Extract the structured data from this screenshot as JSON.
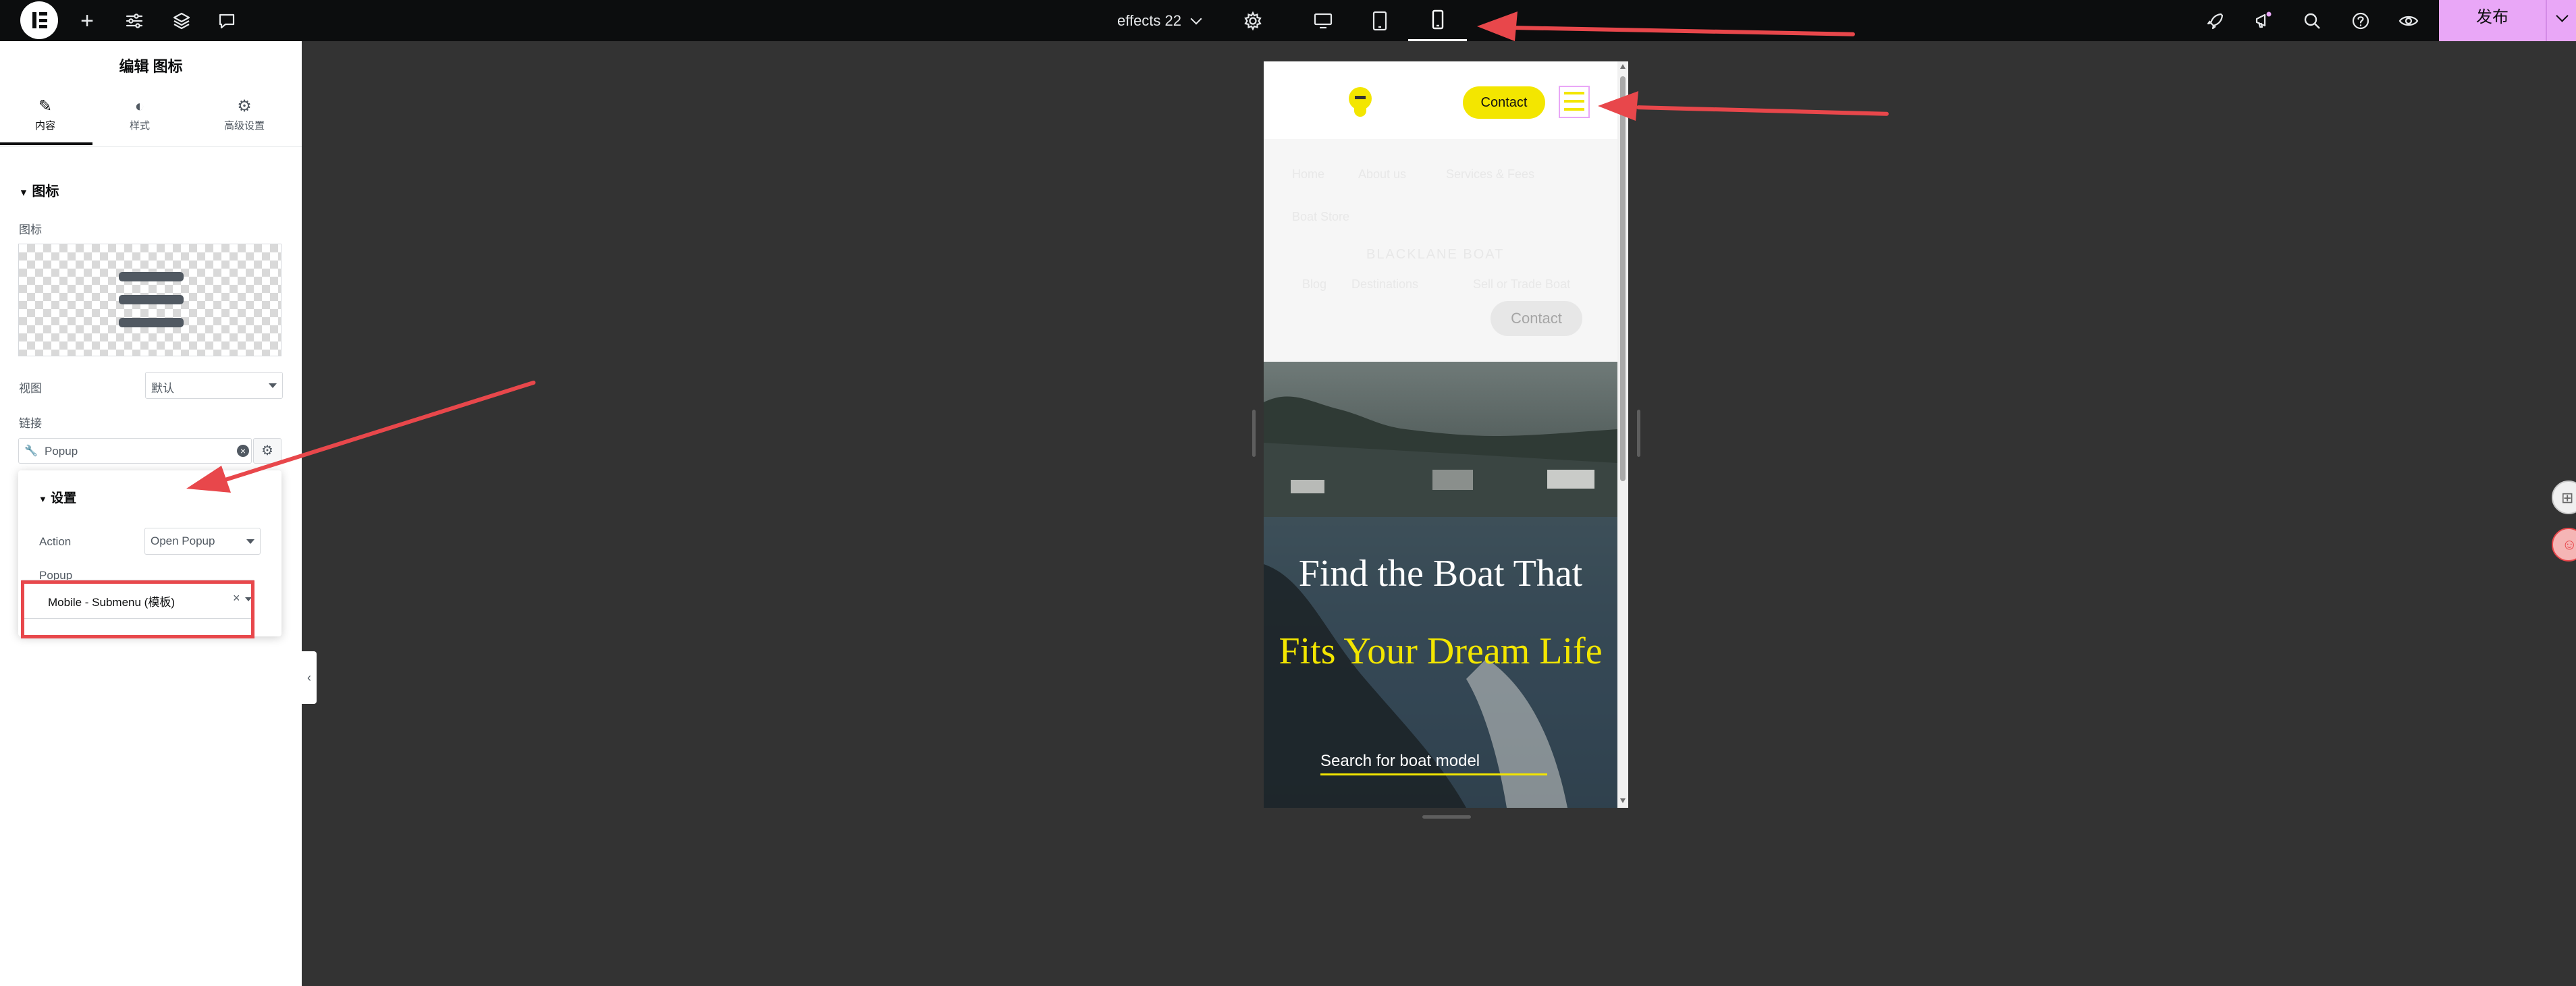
{
  "topbar": {
    "page_name": "effects 22",
    "publish_label": "发布",
    "colors": {
      "background": "#0c0d0e",
      "publish": "#e9a7f7"
    }
  },
  "panel": {
    "title": "编辑 图标",
    "tabs": [
      {
        "icon": "pencil-icon",
        "label": "内容"
      },
      {
        "icon": "half-circle-icon",
        "label": "样式"
      },
      {
        "icon": "gear-icon",
        "label": "高级设置"
      }
    ],
    "section_title": "图标",
    "icon_label": "图标",
    "view_label": "视图",
    "view_value": "默认",
    "link_label": "链接",
    "link_value": "Popup",
    "popover": {
      "title": "设置",
      "action_label": "Action",
      "action_value": "Open Popup",
      "popup_label": "Popup",
      "popup_value": "Mobile - Submenu (模板)",
      "clear_symbol": "×"
    }
  },
  "preview": {
    "contact_button": "Contact",
    "menu_faded": [
      "Home",
      "About us",
      "Services & Fees",
      "Boat Store",
      "BLACKLANE BOAT",
      "Blog",
      "Destinations",
      "Sell or Trade Boat"
    ],
    "contact_faded": "Contact",
    "hero_title_white": "Find the Boat That",
    "hero_title_yellow": "Fits Your Dream Life",
    "search_text": "Search for boat model",
    "accent_color": "#f3e600"
  }
}
